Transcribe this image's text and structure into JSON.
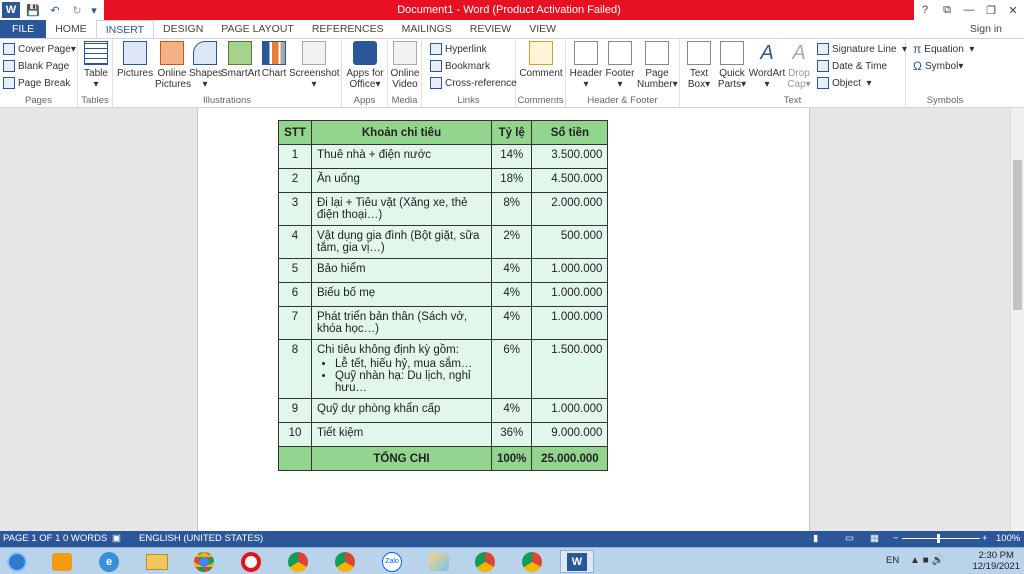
{
  "window": {
    "title": "Document1 - Word (Product Activation Failed)",
    "controls": [
      "?",
      "⧉",
      "—",
      "❐",
      "✕"
    ]
  },
  "tabs": [
    "FILE",
    "HOME",
    "INSERT",
    "DESIGN",
    "PAGE LAYOUT",
    "REFERENCES",
    "MAILINGS",
    "REVIEW",
    "VIEW"
  ],
  "active_tab": "INSERT",
  "sign_in": "Sign in",
  "ribbon": {
    "pages": {
      "items": [
        "Cover Page",
        "Blank Page",
        "Page Break"
      ],
      "label": "Pages"
    },
    "tables": {
      "table": "Table",
      "label": "Tables"
    },
    "illustrations": {
      "pictures": "Pictures",
      "online_pictures_1": "Online",
      "online_pictures_2": "Pictures",
      "shapes": "Shapes",
      "smartart": "SmartArt",
      "chart": "Chart",
      "screenshot": "Screenshot",
      "label": "Illustrations"
    },
    "apps": {
      "apps_1": "Apps for",
      "apps_2": "Office",
      "label": "Apps"
    },
    "media": {
      "video_1": "Online",
      "video_2": "Video",
      "label": "Media"
    },
    "links": {
      "items": [
        "Hyperlink",
        "Bookmark",
        "Cross-reference"
      ],
      "label": "Links"
    },
    "comments": {
      "comment": "Comment",
      "label": "Comments"
    },
    "header_footer": {
      "header": "Header",
      "footer": "Footer",
      "page_number_1": "Page",
      "page_number_2": "Number",
      "label": "Header & Footer"
    },
    "text": {
      "textbox_1": "Text",
      "textbox_2": "Box",
      "quickparts_1": "Quick",
      "quickparts_2": "Parts",
      "wordart": "WordArt",
      "dropcap_1": "Drop",
      "dropcap_2": "Cap",
      "small_items": [
        "Signature Line",
        "Date & Time",
        "Object"
      ],
      "label": "Text"
    },
    "symbols": {
      "items": [
        "Equation",
        "Symbol"
      ],
      "label": "Symbols"
    }
  },
  "table": {
    "headers": [
      "STT",
      "Khoản chi tiêu",
      "Tỷ lệ",
      "Số tiền"
    ],
    "rows": [
      {
        "stt": "1",
        "item": "Thuê nhà + điện nước",
        "rate": "14%",
        "amount": "3.500.000"
      },
      {
        "stt": "2",
        "item": "Ăn uống",
        "rate": "18%",
        "amount": "4.500.000"
      },
      {
        "stt": "3",
        "item": "Đi lại + Tiêu vặt (Xăng xe, thẻ điện thoại…)",
        "rate": "8%",
        "amount": "2.000.000"
      },
      {
        "stt": "4",
        "item": "Vật dụng gia đình (Bột giặt, sữa tắm, gia vị…)",
        "rate": "2%",
        "amount": "500.000"
      },
      {
        "stt": "5",
        "item": "Bảo hiểm",
        "rate": "4%",
        "amount": "1.000.000"
      },
      {
        "stt": "6",
        "item": "Biếu bố mẹ",
        "rate": "4%",
        "amount": "1.000.000"
      },
      {
        "stt": "7",
        "item": "Phát triển bản thân (Sách vở, khóa học…)",
        "rate": "4%",
        "amount": "1.000.000"
      },
      {
        "stt": "8",
        "item": "Chi tiêu không định kỳ gồm:",
        "bullets": [
          "Lễ tết, hiếu hỷ, mua sắm…",
          "Quỹ nhàn hạ: Du lịch, nghỉ hưu…"
        ],
        "rate": "6%",
        "amount": "1.500.000"
      },
      {
        "stt": "9",
        "item": "Quỹ dự phòng khẩn cấp",
        "rate": "4%",
        "amount": "1.000.000"
      },
      {
        "stt": "10",
        "item": "Tiết kiệm",
        "rate": "36%",
        "amount": "9.000.000"
      }
    ],
    "total": {
      "label": "TỔNG CHI",
      "rate": "100%",
      "amount": "25.000.000"
    }
  },
  "status": {
    "page": "PAGE 1 OF 1",
    "words": "0 WORDS",
    "language": "ENGLISH (UNITED STATES)",
    "zoom": "100%"
  },
  "taskbar": {
    "lang": "EN",
    "time": "2:30 PM",
    "date": "12/19/2021",
    "zalo": "Zalo"
  },
  "colors": {
    "accent": "#2b579a",
    "error_title": "#e81123",
    "table_header": "#92d58f",
    "table_cell": "#e2f7ec"
  }
}
